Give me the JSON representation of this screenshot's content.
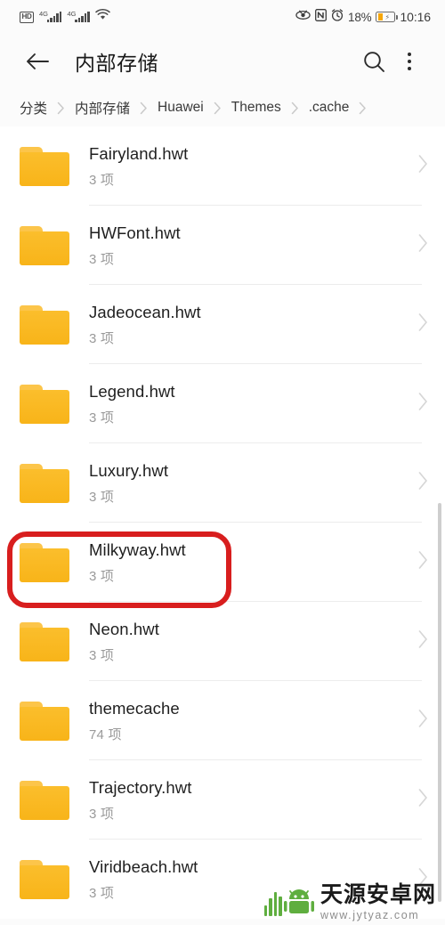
{
  "statusbar": {
    "hd_label": "HD",
    "network1": "4G",
    "network2": "4G",
    "wifi_icon": "wifi-icon",
    "eye_icon": "eye-comfort-icon",
    "nfc_icon": "nfc-icon",
    "alarm_icon": "alarm-clock-icon",
    "battery_percent": "18%",
    "time": "10:16"
  },
  "appbar": {
    "back_icon": "back-arrow-icon",
    "title": "内部存储",
    "search_icon": "search-icon",
    "more_icon": "more-options-icon"
  },
  "breadcrumb": {
    "separator": "›",
    "items": [
      {
        "label": "分类"
      },
      {
        "label": "内部存储"
      },
      {
        "label": "Huawei"
      },
      {
        "label": "Themes"
      },
      {
        "label": ".cache"
      }
    ]
  },
  "list": {
    "chevron_icon": "chevron-right-icon",
    "folder_icon": "folder-icon",
    "items": [
      {
        "name": "Fairyland.hwt",
        "count": "3 项"
      },
      {
        "name": "HWFont.hwt",
        "count": "3 项"
      },
      {
        "name": "Jadeocean.hwt",
        "count": "3 项"
      },
      {
        "name": "Legend.hwt",
        "count": "3 项"
      },
      {
        "name": "Luxury.hwt",
        "count": "3 项"
      },
      {
        "name": "Milkyway.hwt",
        "count": "3 项"
      },
      {
        "name": "Neon.hwt",
        "count": "3 项"
      },
      {
        "name": "themecache",
        "count": "74 项"
      },
      {
        "name": "Trajectory.hwt",
        "count": "3 项"
      },
      {
        "name": "Viridbeach.hwt",
        "count": "3 项"
      }
    ]
  },
  "annotation": {
    "target_item": "Milkyway.hwt",
    "color": "#d81e1e"
  },
  "watermark": {
    "site_name": "天源安卓网",
    "url": "www.jytyaz.com",
    "logo_icon": "android-robot-icon",
    "color": "#5fae3f"
  },
  "colors": {
    "folder": "#f9b721",
    "background": "#fbfbfb",
    "list_background": "#ffffff",
    "divider": "#ececec",
    "secondary_text": "#9a9a9a",
    "primary_text": "#1f1f1f"
  }
}
